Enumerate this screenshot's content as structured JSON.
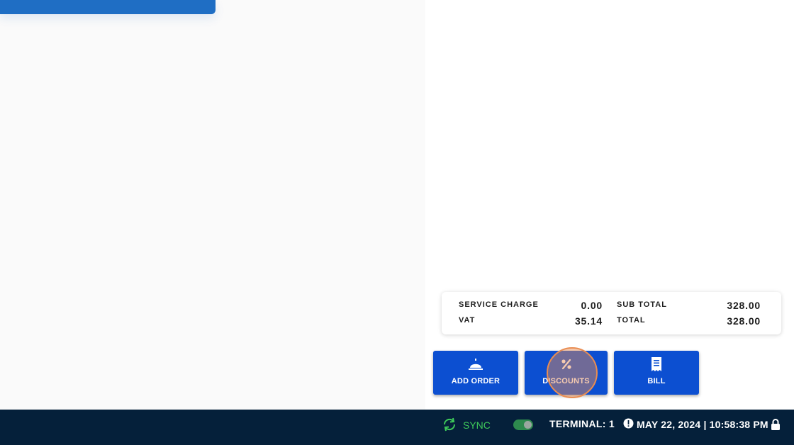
{
  "totals": {
    "service_charge_label": "SERVICE CHARGE",
    "service_charge_value": "0.00",
    "vat_label": "VAT",
    "vat_value": "35.14",
    "sub_total_label": "SUB TOTAL",
    "sub_total_value": "328.00",
    "total_label": "TOTAL",
    "total_value": "328.00"
  },
  "actions": {
    "add_order_label": "ADD ORDER",
    "discounts_label": "DISCOUNTS",
    "bill_label": "BILL"
  },
  "status_bar": {
    "sync_label": "SYNC",
    "sync_toggle_on": true,
    "terminal_label": "TERMINAL: 1",
    "datetime": "MAY 22, 2024 | 10:58:38 PM"
  },
  "icons": {
    "add_order": "service-bell-icon",
    "discounts": "percent-icon",
    "bill": "receipt-icon",
    "sync": "sync-icon",
    "alert": "alert-circle-icon",
    "lock": "lock-icon"
  },
  "colors": {
    "accent": "#0c4fd1",
    "header_blue": "#1f6ec4",
    "status_bg": "#05203a",
    "sync_green": "#3ec95a",
    "highlight": "#e98d52"
  }
}
